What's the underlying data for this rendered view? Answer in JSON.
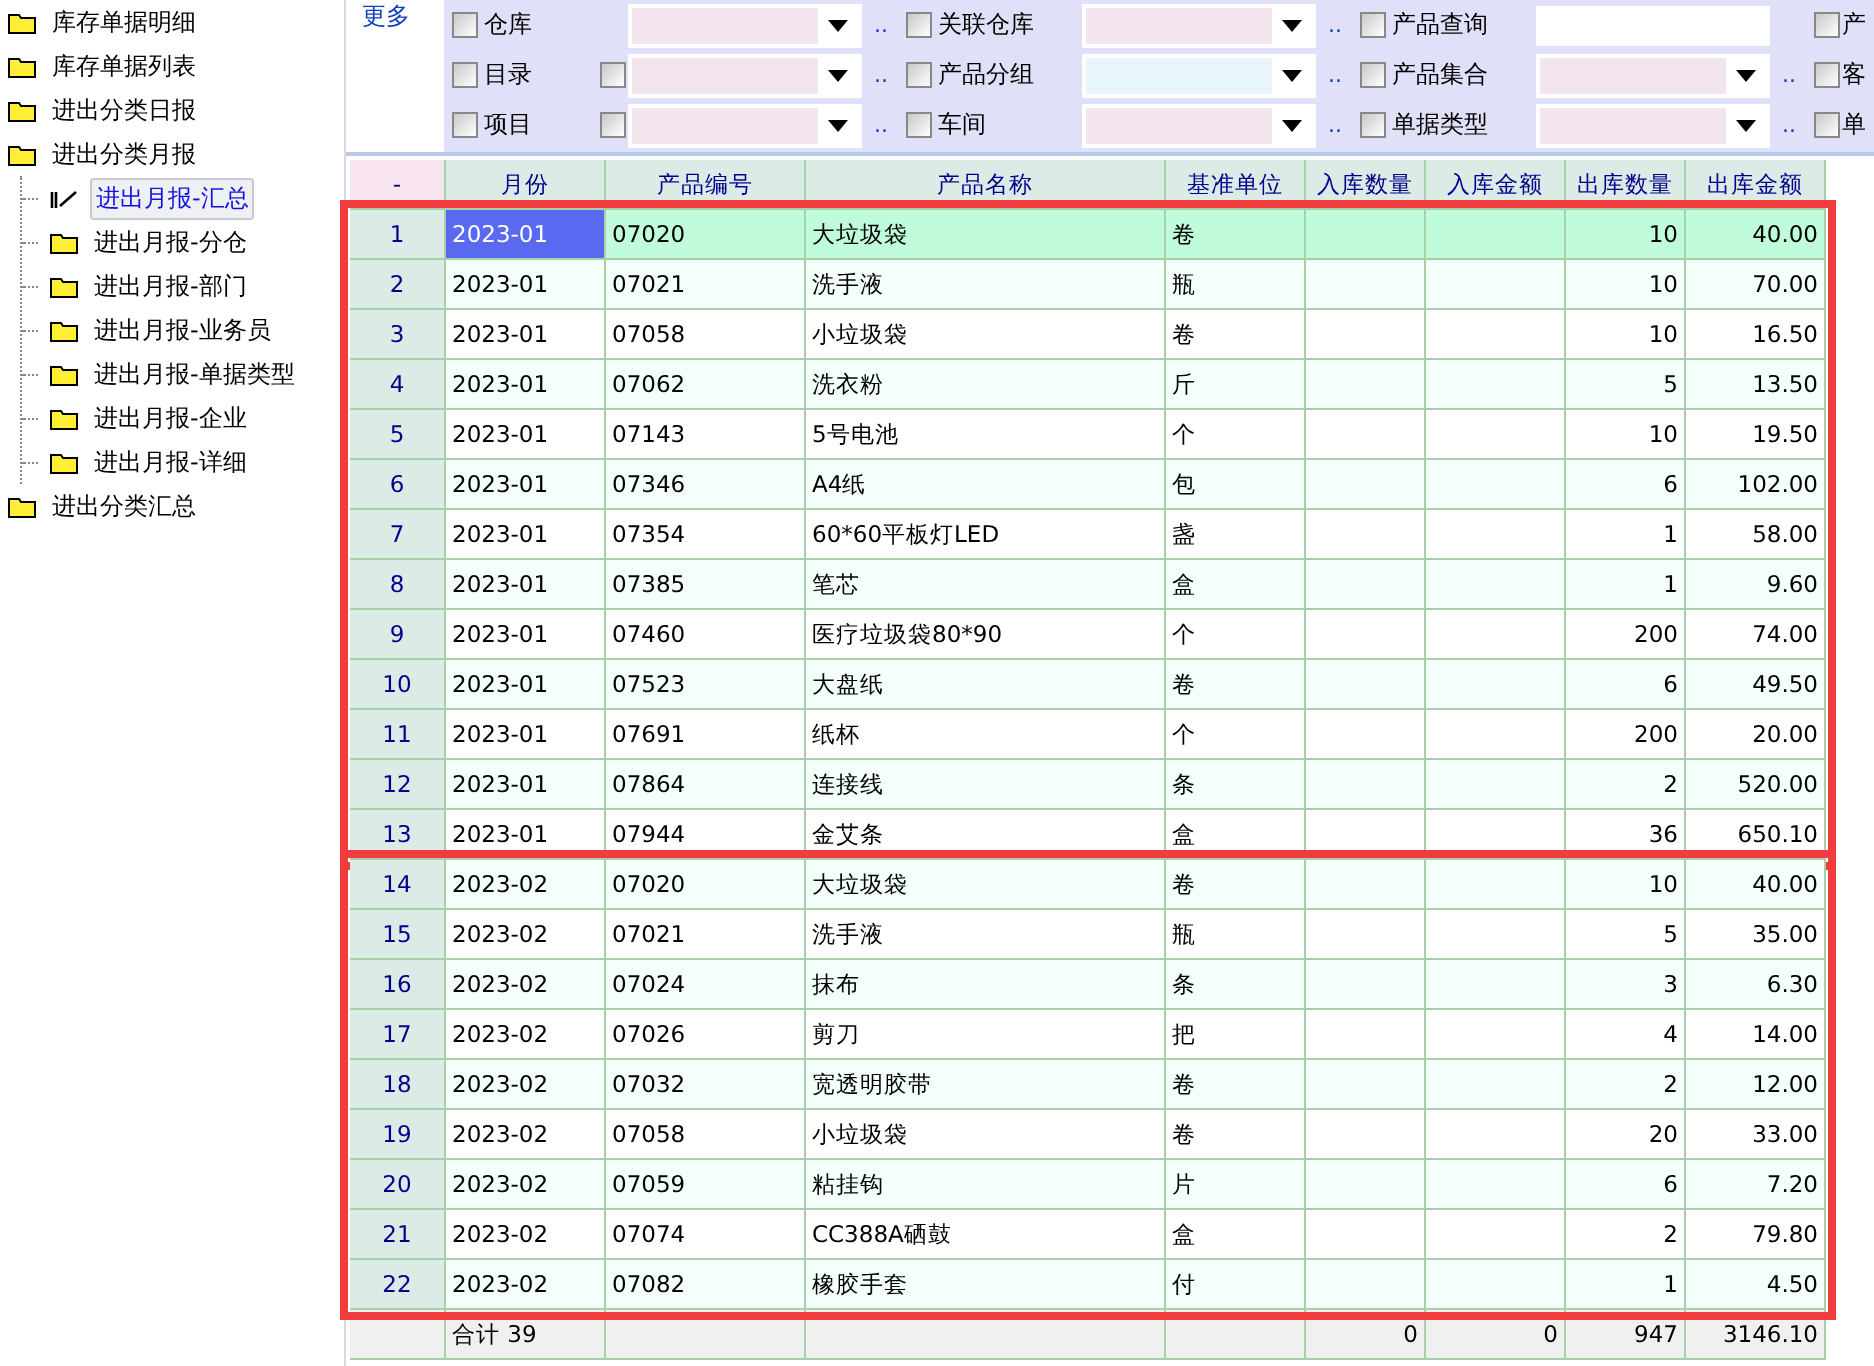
{
  "tree": [
    {
      "label": "库存单据明细",
      "selected": false
    },
    {
      "label": "库存单据列表",
      "selected": false
    },
    {
      "label": "进出分类日报",
      "selected": false
    },
    {
      "label": "进出分类月报",
      "selected": false,
      "children": [
        {
          "label": "进出月报-汇总",
          "selected": true
        },
        {
          "label": "进出月报-分仓",
          "selected": false
        },
        {
          "label": "进出月报-部门",
          "selected": false
        },
        {
          "label": "进出月报-业务员",
          "selected": false
        },
        {
          "label": "进出月报-单据类型",
          "selected": false
        },
        {
          "label": "进出月报-企业",
          "selected": false
        },
        {
          "label": "进出月报-详细",
          "selected": false
        }
      ]
    },
    {
      "label": "进出分类汇总",
      "selected": false
    }
  ],
  "more_link": "更多",
  "filters": [
    [
      {
        "kind": "combo",
        "label": "仓库",
        "checked": false,
        "color": "#f4e4ee"
      },
      {
        "kind": "combo",
        "label": "关联仓库",
        "checked": false,
        "color": "#f4e4ee"
      },
      {
        "kind": "text",
        "label": "产品查询",
        "checked": false
      },
      {
        "kind": "partial",
        "label": "产",
        "checked": false
      }
    ],
    [
      {
        "kind": "combo",
        "label": "目录",
        "checked": false,
        "extra_checked": false,
        "color": "#f4e4ee"
      },
      {
        "kind": "combo",
        "label": "产品分组",
        "checked": false,
        "color": "#e8f6fc"
      },
      {
        "kind": "combo",
        "label": "产品集合",
        "checked": false,
        "color": "#f4e4ee"
      },
      {
        "kind": "partial",
        "label": "客",
        "checked": false
      }
    ],
    [
      {
        "kind": "combo",
        "label": "项目",
        "checked": false,
        "extra_checked": false,
        "color": "#f4e4ee"
      },
      {
        "kind": "combo",
        "label": "车间",
        "checked": false,
        "color": "#f4e4ee"
      },
      {
        "kind": "combo",
        "label": "单据类型",
        "checked": false,
        "color": "#f4e4ee"
      },
      {
        "kind": "partial",
        "label": "单",
        "checked": false
      }
    ]
  ],
  "filter_dots": "..",
  "table": {
    "columns": [
      "-",
      "月份",
      "产品编号",
      "产品名称",
      "基准单位",
      "入库数量",
      "入库金额",
      "出库数量",
      "出库金额"
    ],
    "groups": [
      {
        "framed": true,
        "rows": [
          {
            "no": "1",
            "month": "2023-01",
            "code": "07020",
            "name": "大垃圾袋",
            "unit": "卷",
            "out_qty": "10",
            "out_amount": "40.00",
            "selected": true
          },
          {
            "no": "2",
            "month": "2023-01",
            "code": "07021",
            "name": "洗手液",
            "unit": "瓶",
            "out_qty": "10",
            "out_amount": "70.00",
            "selected": false
          },
          {
            "no": "3",
            "month": "2023-01",
            "code": "07058",
            "name": "小垃圾袋",
            "unit": "卷",
            "out_qty": "10",
            "out_amount": "16.50",
            "selected": false
          },
          {
            "no": "4",
            "month": "2023-01",
            "code": "07062",
            "name": "洗衣粉",
            "unit": "斤",
            "out_qty": "5",
            "out_amount": "13.50",
            "selected": false
          },
          {
            "no": "5",
            "month": "2023-01",
            "code": "07143",
            "name": "5号电池",
            "unit": "个",
            "out_qty": "10",
            "out_amount": "19.50",
            "selected": false
          },
          {
            "no": "6",
            "month": "2023-01",
            "code": "07346",
            "name": "A4纸",
            "unit": "包",
            "out_qty": "6",
            "out_amount": "102.00",
            "selected": false
          },
          {
            "no": "7",
            "month": "2023-01",
            "code": "07354",
            "name": "60*60平板灯LED",
            "unit": "盏",
            "out_qty": "1",
            "out_amount": "58.00",
            "selected": false
          },
          {
            "no": "8",
            "month": "2023-01",
            "code": "07385",
            "name": "笔芯",
            "unit": "盒",
            "out_qty": "1",
            "out_amount": "9.60",
            "selected": false
          },
          {
            "no": "9",
            "month": "2023-01",
            "code": "07460",
            "name": "医疗垃圾袋80*90",
            "unit": "个",
            "out_qty": "200",
            "out_amount": "74.00",
            "selected": false
          },
          {
            "no": "10",
            "month": "2023-01",
            "code": "07523",
            "name": "大盘纸",
            "unit": "卷",
            "out_qty": "6",
            "out_amount": "49.50",
            "selected": false
          },
          {
            "no": "11",
            "month": "2023-01",
            "code": "07691",
            "name": "纸杯",
            "unit": "个",
            "out_qty": "200",
            "out_amount": "20.00",
            "selected": false
          },
          {
            "no": "12",
            "month": "2023-01",
            "code": "07864",
            "name": "连接线",
            "unit": "条",
            "out_qty": "2",
            "out_amount": "520.00",
            "selected": false
          },
          {
            "no": "13",
            "month": "2023-01",
            "code": "07944",
            "name": "金艾条",
            "unit": "盒",
            "out_qty": "36",
            "out_amount": "650.10",
            "selected": false
          }
        ]
      },
      {
        "framed": true,
        "rows": [
          {
            "no": "14",
            "month": "2023-02",
            "code": "07020",
            "name": "大垃圾袋",
            "unit": "卷",
            "out_qty": "10",
            "out_amount": "40.00",
            "selected": false
          },
          {
            "no": "15",
            "month": "2023-02",
            "code": "07021",
            "name": "洗手液",
            "unit": "瓶",
            "out_qty": "5",
            "out_amount": "35.00",
            "selected": false
          },
          {
            "no": "16",
            "month": "2023-02",
            "code": "07024",
            "name": "抹布",
            "unit": "条",
            "out_qty": "3",
            "out_amount": "6.30",
            "selected": false
          },
          {
            "no": "17",
            "month": "2023-02",
            "code": "07026",
            "name": "剪刀",
            "unit": "把",
            "out_qty": "4",
            "out_amount": "14.00",
            "selected": false
          },
          {
            "no": "18",
            "month": "2023-02",
            "code": "07032",
            "name": "宽透明胶带",
            "unit": "卷",
            "out_qty": "2",
            "out_amount": "12.00",
            "selected": false
          },
          {
            "no": "19",
            "month": "2023-02",
            "code": "07058",
            "name": "小垃圾袋",
            "unit": "卷",
            "out_qty": "20",
            "out_amount": "33.00",
            "selected": false
          },
          {
            "no": "20",
            "month": "2023-02",
            "code": "07059",
            "name": "粘挂钩",
            "unit": "片",
            "out_qty": "6",
            "out_amount": "7.20",
            "selected": false
          },
          {
            "no": "21",
            "month": "2023-02",
            "code": "07074",
            "name": "CC388A硒鼓",
            "unit": "盒",
            "out_qty": "2",
            "out_amount": "79.80",
            "selected": false
          },
          {
            "no": "22",
            "month": "2023-02",
            "code": "07082",
            "name": "橡胶手套",
            "unit": "付",
            "out_qty": "1",
            "out_amount": "4.50",
            "selected": false
          }
        ]
      }
    ],
    "totals": {
      "label": "合计 39",
      "in_qty": "0",
      "in_amount": "0",
      "out_qty": "947",
      "out_amount": "3146.10"
    }
  }
}
